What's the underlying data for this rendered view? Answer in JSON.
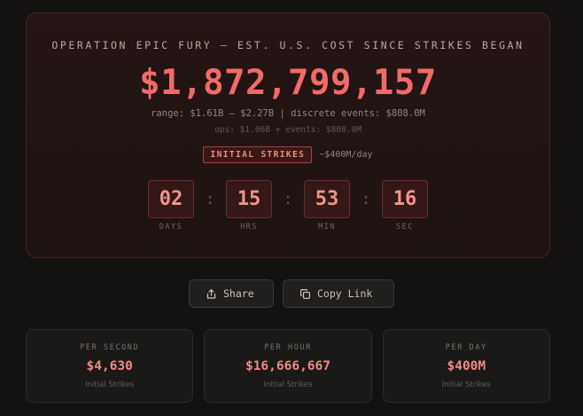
{
  "hero": {
    "title": "OPERATION EPIC FURY — EST. U.S. COST SINCE STRIKES BEGAN",
    "total": "$1,872,799,157",
    "range_line": "range: $1.61B – $2.27B | discrete events: $808.0M",
    "ops_line": "ops: $1.06B + events: $808.0M",
    "phase_badge": "INITIAL STRIKES",
    "phase_rate": "~$400M/day",
    "countdown": [
      {
        "value": "02",
        "label": "DAYS"
      },
      {
        "value": "15",
        "label": "HRS"
      },
      {
        "value": "53",
        "label": "MIN"
      },
      {
        "value": "16",
        "label": "SEC"
      }
    ],
    "separator": ":"
  },
  "actions": {
    "share_label": "Share",
    "share_icon": "share-icon",
    "copy_label": "Copy Link",
    "copy_icon": "copy-icon"
  },
  "stats": [
    {
      "label": "PER SECOND",
      "value": "$4,630",
      "sub": "Initial Strikes"
    },
    {
      "label": "PER HOUR",
      "value": "$16,666,667",
      "sub": "Initial Strikes"
    },
    {
      "label": "PER DAY",
      "value": "$400M",
      "sub": "Initial Strikes"
    }
  ],
  "colors": {
    "accent": "#ef6b68",
    "background": "#131211",
    "hero_border": "#4a2422"
  }
}
